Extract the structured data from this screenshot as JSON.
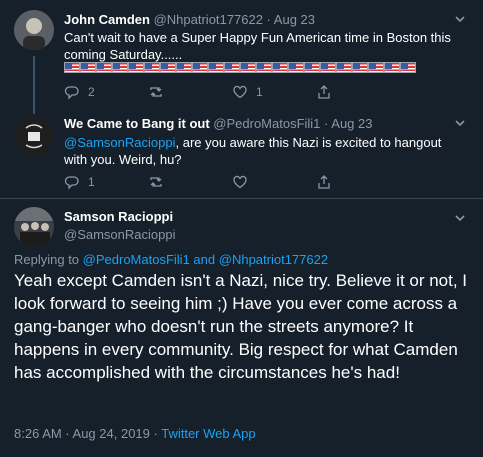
{
  "tweets": [
    {
      "name": "John Camden",
      "handle": "@Nhpatriot177622",
      "sep": "·",
      "time": "Aug 23",
      "text": "Can't wait to have a Super Happy Fun American time in Boston this coming Saturday......",
      "flag_emoji_count": 22,
      "replies": "2",
      "retweets": "",
      "likes": "1"
    },
    {
      "name": "We Came to Bang it out",
      "handle": "@PedroMatosFili1",
      "sep": "·",
      "time": "Aug 23",
      "mention": "@SamsonRacioppi",
      "text": ", are you aware this Nazi is excited to hangout with you. Weird, hu?",
      "replies": "1",
      "retweets": "",
      "likes": ""
    }
  ],
  "main_tweet": {
    "name": "Samson Racioppi",
    "handle": "@SamsonRacioppi",
    "replying_prefix": "Replying to",
    "replying_user_1": "@PedroMatosFili1",
    "replying_and": "and",
    "replying_user_2": "@Nhpatriot177622",
    "text": "Yeah except Camden isn't a Nazi, nice try. Believe it or not, I look forward to seeing him ;) Have you ever come across a gang-banger who doesn't run the streets anymore? It happens in every community. Big respect for what Camden has accomplished with the circumstances he's had!",
    "timestamp": "8:26 AM · Aug 24, 2019 ·",
    "app": "Twitter Web App"
  },
  "colors": {
    "background": "#15202b",
    "secondary_text": "#8899a6",
    "link": "#1da1f2",
    "divider": "#38444d"
  },
  "icons": [
    "chevron-down-icon",
    "reply-icon",
    "retweet-icon",
    "like-icon",
    "share-icon",
    "us-flag-icon"
  ]
}
